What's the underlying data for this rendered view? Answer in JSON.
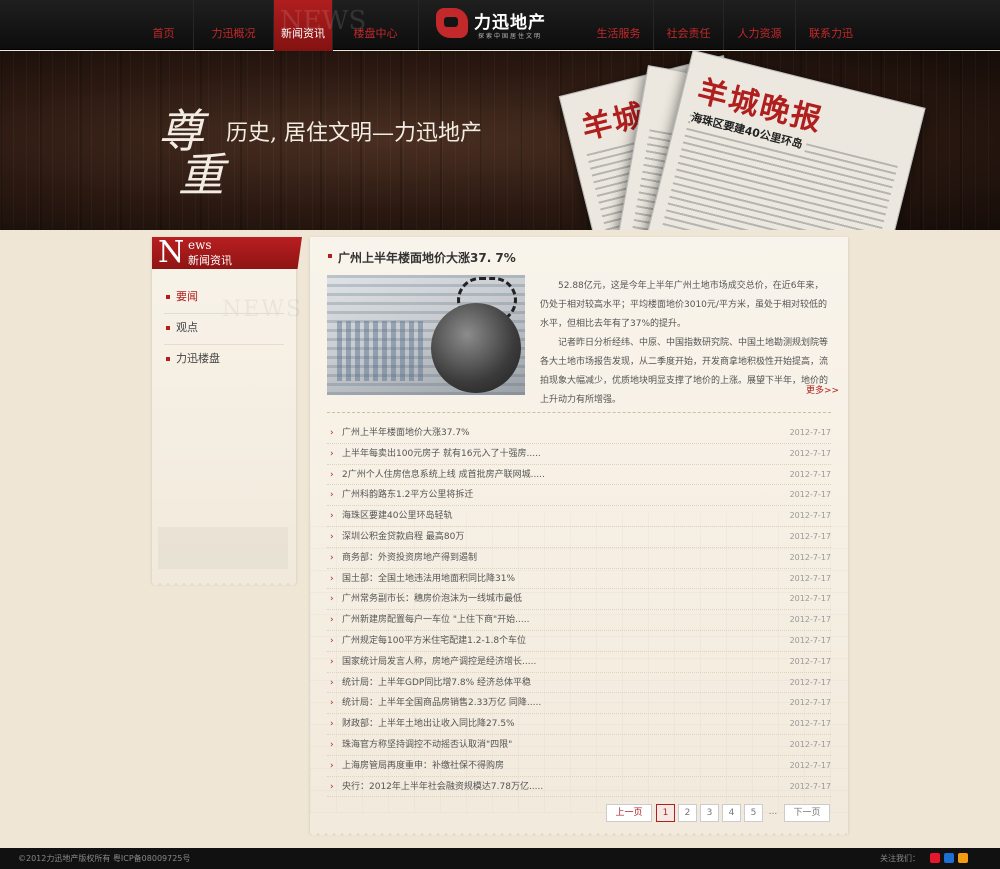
{
  "nav": {
    "left": [
      "首页",
      "力迅概况",
      "新闻资讯",
      "楼盘中心"
    ],
    "right": [
      "生活服务",
      "社会责任",
      "人力资源",
      "联系力迅"
    ],
    "active": "新闻资讯",
    "active_ghost": "NEWS"
  },
  "logo": {
    "name": "力迅地产",
    "slogan": "探索中国居住文明"
  },
  "banner": {
    "calligraphy_1": "尊",
    "calligraphy_2": "重",
    "slogan": "历史, 居住文明—力迅地产",
    "newspaper_title": "羊城晚报",
    "newspaper_headline": "海珠区要建40公里环岛"
  },
  "sidebar": {
    "head_big": "N",
    "head_small": "ews",
    "head_cn": "新闻资讯",
    "ghost": "NEWS",
    "items": [
      "要闻",
      "观点",
      "力迅楼盘"
    ],
    "active_index": 0
  },
  "article": {
    "title": "广州上半年楼面地价大涨37. 7%",
    "para1": "52.88亿元，这是今年上半年广州土地市场成交总价，在近6年来，仍处于相对较高水平；平均楼面地价3010元/平方米，虽处于相对较低的水平，但相比去年有了37%的提升。",
    "para2": "记者昨日分析经纬、中原、中国指数研究院、中国土地勘测规划院等各大土地市场报告发现，从二季度开始，开发商拿地积极性开始提高，流拍现象大幅减少，优质地块明显支撑了地价的上涨。展望下半年，地价的上升动力有所增强。",
    "more": "更多>>"
  },
  "news": [
    {
      "title": "广州上半年楼面地价大涨37.7%",
      "date": "2012-7-17"
    },
    {
      "title": "上半年每卖出100元房子 就有16元入了十强房.....",
      "date": "2012-7-17"
    },
    {
      "title": "2广州个人住房信息系统上线 成首批房产联网城.....",
      "date": "2012-7-17"
    },
    {
      "title": "广州科韵路东1.2平方公里将拆迁",
      "date": "2012-7-17"
    },
    {
      "title": "海珠区要建40公里环岛轻轨",
      "date": "2012-7-17"
    },
    {
      "title": "深圳公积金贷款启程 最高80万",
      "date": "2012-7-17"
    },
    {
      "title": "商务部：外资投资房地产得到遏制",
      "date": "2012-7-17"
    },
    {
      "title": "国土部：全国土地违法用地面积同比降31%",
      "date": "2012-7-17"
    },
    {
      "title": "广州常务副市长：穗房价泡沫为一线城市最低",
      "date": "2012-7-17"
    },
    {
      "title": "广州新建房配置每户一车位 \"上住下商\"开始.....",
      "date": "2012-7-17"
    },
    {
      "title": "广州规定每100平方米住宅配建1.2-1.8个车位",
      "date": "2012-7-17"
    },
    {
      "title": "国家统计局发言人称，房地产调控是经济增长.....",
      "date": "2012-7-17"
    },
    {
      "title": "统计局：上半年GDP同比增7.8% 经济总体平稳",
      "date": "2012-7-17"
    },
    {
      "title": "统计局：上半年全国商品房销售2.33万亿 同降.....",
      "date": "2012-7-17"
    },
    {
      "title": "财政部：上半年土地出让收入同比降27.5%",
      "date": "2012-7-17"
    },
    {
      "title": "珠海官方称坚持调控不动摇否认取消\"四限\"",
      "date": "2012-7-17"
    },
    {
      "title": "上海房管局再度重申：补缴社保不得购房",
      "date": "2012-7-17"
    },
    {
      "title": "央行：2012年上半年社会融资规模达7.78万亿.....",
      "date": "2012-7-17"
    }
  ],
  "pager": {
    "prev": "上一页",
    "pages": [
      "1",
      "2",
      "3",
      "4",
      "5"
    ],
    "dots": "...",
    "next": "下一页",
    "current": "1"
  },
  "footer": {
    "copyright": "©2012力迅地产版权所有 粤ICP备08009725号",
    "follow": "关注我们："
  },
  "colors": {
    "accent": "#b01e1e",
    "nav_bg": "#151515",
    "page_bg": "#efe6d6"
  },
  "icons": [
    "weibo-icon",
    "people-icon",
    "qq-icon"
  ]
}
